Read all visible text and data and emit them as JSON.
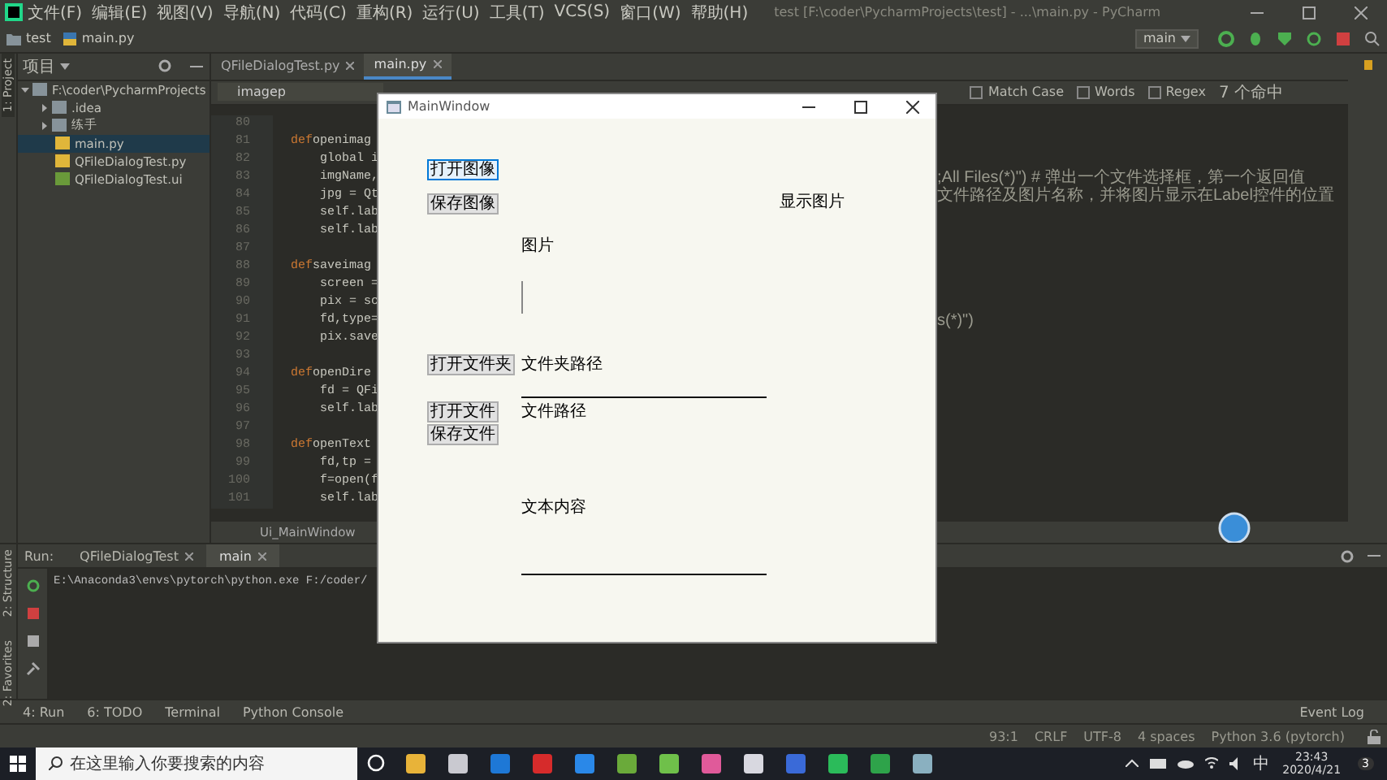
{
  "ide": {
    "title": "test [F:\\coder\\PycharmProjects\\test] - ...\\main.py - PyCharm",
    "menu": [
      "文件(F)",
      "编辑(E)",
      "视图(V)",
      "导航(N)",
      "代码(C)",
      "重构(R)",
      "运行(U)",
      "工具(T)",
      "VCS(S)",
      "窗口(W)",
      "帮助(H)"
    ],
    "breadcrumb": [
      "test",
      "main.py"
    ],
    "branch": "main",
    "left_strip": [
      "1: Project"
    ],
    "left_strip_bottom": [
      "2: Structure",
      "2: Favorites"
    ],
    "project": {
      "header": "项目",
      "tree": [
        {
          "label": "F:\\coder\\PycharmProjects",
          "kind": "folder",
          "expanded": true,
          "selected": false,
          "children": [
            {
              "label": ".idea",
              "kind": "folder",
              "expanded": false,
              "selected": false
            },
            {
              "label": "练手",
              "kind": "folder",
              "expanded": false,
              "selected": false
            },
            {
              "label": "main.py",
              "kind": "py",
              "selected": true
            },
            {
              "label": "QFileDialogTest.py",
              "kind": "py",
              "selected": false
            },
            {
              "label": "QFileDialogTest.ui",
              "kind": "ui",
              "selected": false
            }
          ]
        }
      ]
    },
    "editor_tabs": [
      {
        "label": "QFileDialogTest.py",
        "selected": false
      },
      {
        "label": "main.py",
        "selected": true
      }
    ],
    "search": {
      "value": "imagep",
      "options": [
        {
          "label": "Match Case",
          "checked": false
        },
        {
          "label": "Words",
          "checked": false
        },
        {
          "label": "Regex",
          "checked": false
        }
      ],
      "matches": "7 个命中"
    },
    "code_lines": [
      {
        "number": "80"
      },
      {
        "number": "81",
        "keyword": "def",
        "text": "openimag"
      },
      {
        "number": "82",
        "text": "    global i"
      },
      {
        "number": "83",
        "text": "    imgName,",
        "tail": ";All Files(*)\") # 弹出一个文件选择框，第一个返回值"
      },
      {
        "number": "84",
        "text": "    jpg = Qt",
        "tail": "文件路径及图片名称，并将图片显示在Label控件的位置"
      },
      {
        "number": "85",
        "text": "    self.lab"
      },
      {
        "number": "86",
        "text": "    self.lab"
      },
      {
        "number": "87"
      },
      {
        "number": "88",
        "keyword": "def",
        "text": "saveimag"
      },
      {
        "number": "89",
        "text": "    screen ="
      },
      {
        "number": "90",
        "text": "    pix = sc"
      },
      {
        "number": "91",
        "text": "    fd,type=",
        "tail": "s(*)\")"
      },
      {
        "number": "92",
        "text": "    pix.save"
      },
      {
        "number": "93"
      },
      {
        "number": "94",
        "keyword": "def",
        "text": "openDire"
      },
      {
        "number": "95",
        "text": "    fd = QFi"
      },
      {
        "number": "96",
        "text": "    self.lab"
      },
      {
        "number": "97"
      },
      {
        "number": "98",
        "keyword": "def",
        "text": "openText"
      },
      {
        "number": "99",
        "text": "    fd,tp ="
      },
      {
        "number": "100",
        "text": "    f=open(f"
      },
      {
        "number": "101",
        "text": "    self.lab"
      }
    ],
    "editor_breadcrumb": "Ui_MainWindow",
    "run_panel": {
      "label": "Run:",
      "tabs": [
        {
          "label": "QFileDialogTest",
          "selected": false
        },
        {
          "label": "main",
          "selected": true
        }
      ],
      "console": "E:\\Anaconda3\\envs\\pytorch\\python.exe F:/coder/"
    },
    "tool_tabs": [
      "4: Run",
      "6: TODO",
      "Terminal",
      "Python Console"
    ],
    "event_log": "Event Log",
    "status": [
      "93:1",
      "CRLF",
      "UTF-8",
      "4 spaces",
      "Python 3.6 (pytorch)"
    ]
  },
  "dialog": {
    "title": "MainWindow",
    "buttons": [
      {
        "label": "打开图像",
        "focused": true
      },
      {
        "label": "保存图像",
        "focused": false
      },
      {
        "label": "打开文件夹",
        "focused": false
      },
      {
        "label": "打开文件",
        "focused": false
      },
      {
        "label": "保存文件",
        "focused": false
      }
    ],
    "image_caption": "显示图片",
    "image_label": "图片",
    "folder_label": "文件夹路径",
    "file_label": "文件路径",
    "text_label": "文本内容"
  },
  "taskbar": {
    "search_placeholder": "在这里输入你要搜索的内容",
    "input_method": "中",
    "time": "23:43",
    "date": "2020/4/21",
    "notifications": "3"
  }
}
